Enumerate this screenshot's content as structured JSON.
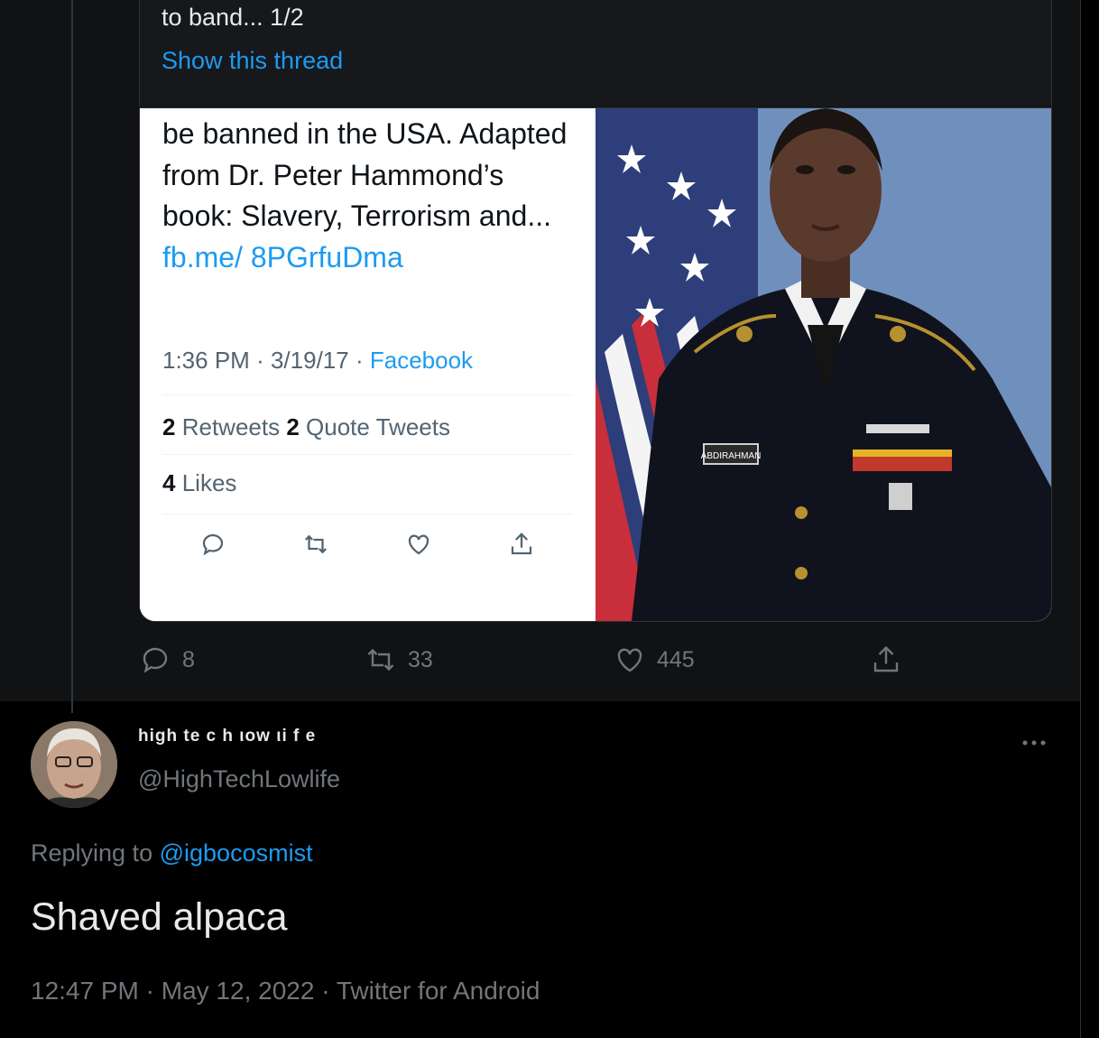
{
  "quoted_tweet": {
    "text_tail": "to band... 1/2",
    "show_thread_label": "Show this thread",
    "screenshot": {
      "body": "be banned in the USA. Adapted from Dr. Peter Hammond’s book: Slavery, Terrorism and...",
      "link": "fb.me/ 8PGrfuDma",
      "time": "1:36 PM",
      "date": "3/19/17",
      "source": "Facebook",
      "retweets_count": "2",
      "retweets_label": "Retweets",
      "quotes_count": "2",
      "quotes_label": "Quote Tweets",
      "likes_count": "4",
      "likes_label": "Likes",
      "icons": [
        "reply-icon",
        "retweet-icon",
        "like-icon",
        "share-icon"
      ]
    },
    "photo": {
      "name_tag": "ABDIRAHMAN"
    }
  },
  "parent_actions": {
    "replies": "8",
    "retweets": "33",
    "likes": "445",
    "icons": [
      "reply-icon",
      "retweet-icon",
      "like-icon",
      "share-icon"
    ]
  },
  "reply_tweet": {
    "display_name": "high te c h ιow ιi f e",
    "handle": "@HighTechLowlife",
    "replying_prefix": "Replying to",
    "replying_mention": "@igbocosmist",
    "text": "Shaved alpaca",
    "time": "12:47 PM",
    "date": "May 12, 2022",
    "client": "Twitter for Android",
    "separator": "·"
  },
  "colors": {
    "background": "#000000",
    "link": "#1d9bf0",
    "secondary_text": "#71767b",
    "primary_text": "#e7e9ea"
  }
}
